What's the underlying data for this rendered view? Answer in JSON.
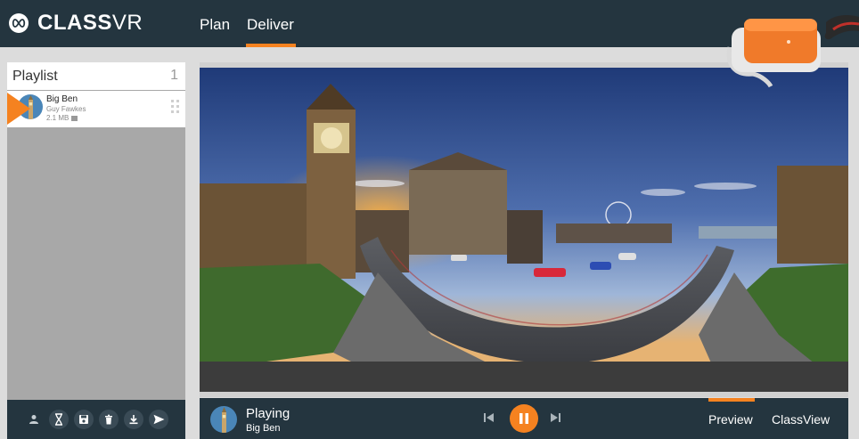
{
  "app": {
    "logo_bold": "CLASS",
    "logo_light": "VR"
  },
  "nav": {
    "plan": "Plan",
    "deliver": "Deliver",
    "active": "Deliver"
  },
  "playlist": {
    "title": "Playlist",
    "count": "1",
    "items": [
      {
        "title": "Big Ben",
        "subtitle": "Guy Fawkes",
        "size": "2.1 MB"
      }
    ]
  },
  "toolbar": {
    "icons": [
      "person-icon",
      "hourglass-icon",
      "save-icon",
      "trash-icon",
      "download-icon",
      "send-icon"
    ]
  },
  "player": {
    "status": "Playing",
    "title": "Big Ben",
    "tabs": {
      "preview": "Preview",
      "classview": "ClassView",
      "active": "Preview"
    }
  },
  "colors": {
    "topbar": "#24353f",
    "accent": "#f58220",
    "panel_bg": "#a8a8a8",
    "page_bg": "#dcdcdc"
  }
}
